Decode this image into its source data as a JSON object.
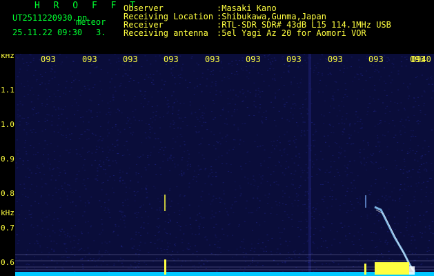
{
  "header": {
    "station": "H R O F F T",
    "filename": "UT2511220930.pn",
    "tag": "meteor",
    "datetime": "25.11.22 09:30",
    "count": "3."
  },
  "info": [
    {
      "label": "Observer",
      "value": ":Masaki Kano"
    },
    {
      "label": "Receiving Location",
      "value": ":Shibukawa,Gunma,Japan"
    },
    {
      "label": "Receiver",
      "value": ":RTL-SDR SDR# 43dB L15 114.1MHz USB"
    },
    {
      "label": "Receiving antenna",
      "value": ":5el Yagi Az 20 for Aomori VOR"
    }
  ],
  "axis": {
    "unit_top": "kHz",
    "unit_mid": "kHz",
    "freq_ticks": [
      "1.1",
      "1.0",
      "0.9",
      "0.8",
      "0.7",
      "0.6"
    ],
    "time_labels": [
      "093",
      "093",
      "093",
      "093",
      "093",
      "093",
      "093",
      "093",
      "093",
      "093",
      "0940"
    ]
  },
  "colors": {
    "background": "#000000",
    "noise": "#1a1f78",
    "signal": "#ffff40",
    "trace": "#8fd0ff",
    "baseline": "#00c8ff",
    "text": "#ffff40",
    "title": "#00ff30"
  }
}
